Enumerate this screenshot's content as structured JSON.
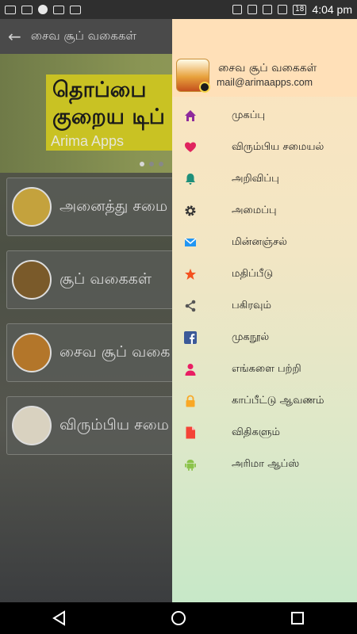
{
  "status_bar": {
    "time": "4:04 pm",
    "battery": "18"
  },
  "background": {
    "toolbar_title": "சைவ சூப் வகைகள்",
    "banner_line1": "தொப்பை",
    "banner_line2": "குறைய டிப்",
    "banner_sub": "Arima Apps",
    "categories": [
      {
        "label": "அனைத்து சமை"
      },
      {
        "label": "சூப் வகைகள்"
      },
      {
        "label": "சைவ சூப் வகை"
      },
      {
        "label": "விரும்பிய சமை"
      }
    ]
  },
  "drawer": {
    "app_name": "சைவ சூப் வகைகள்",
    "email": "mail@arimaapps.com",
    "items": [
      {
        "label": "முகப்பு",
        "icon": "home-icon",
        "color": "#8e2a9c"
      },
      {
        "label": "விரும்பிய சமையல்",
        "icon": "heart-icon",
        "color": "#e0245e"
      },
      {
        "label": "அறிவிப்பு",
        "icon": "bell-icon",
        "color": "#1f8f7a"
      },
      {
        "label": "அமைப்பு",
        "icon": "gear-icon",
        "color": "#333333"
      },
      {
        "label": "மின்னஞ்சல்",
        "icon": "mail-icon",
        "color": "#2196f3"
      },
      {
        "label": "மதிப்பீடு",
        "icon": "star-icon",
        "color": "#f4511e"
      },
      {
        "label": "பகிரவும்",
        "icon": "share-icon",
        "color": "#555555"
      },
      {
        "label": "முகநூல்",
        "icon": "facebook-icon",
        "color": "#3b5998"
      },
      {
        "label": "எங்களை பற்றி",
        "icon": "person-icon",
        "color": "#e91e63"
      },
      {
        "label": "காப்பீட்டு ஆவணம்",
        "icon": "lock-icon",
        "color": "#f9a825"
      },
      {
        "label": "விதிகளும்",
        "icon": "document-icon",
        "color": "#f44336"
      },
      {
        "label": "அரிமா ஆப்ஸ்",
        "icon": "android-icon",
        "color": "#8bc34a"
      }
    ]
  }
}
